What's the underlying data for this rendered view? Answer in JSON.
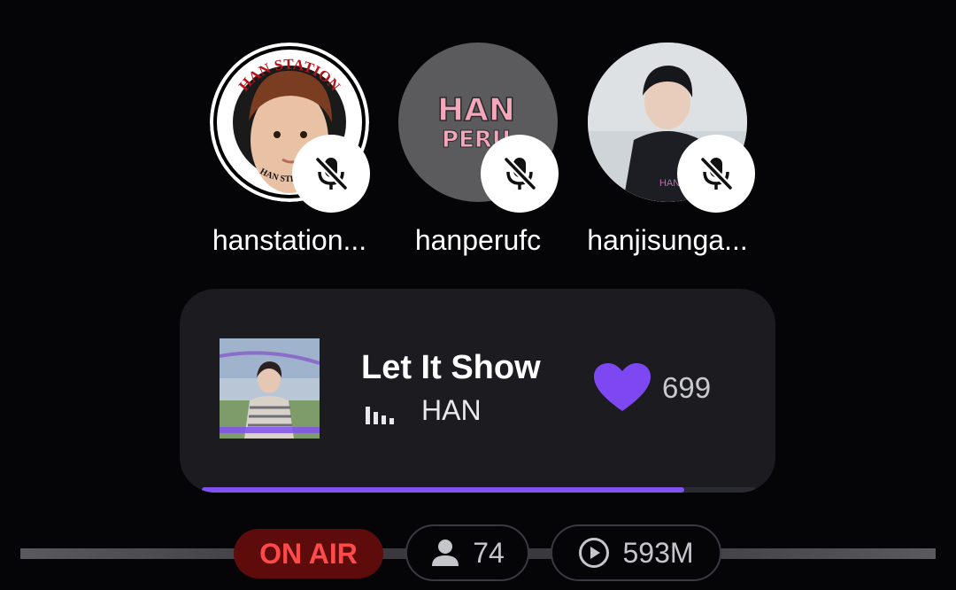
{
  "speakers": [
    {
      "name": "hanstation...",
      "avatar_text_top": "HAN STATION",
      "avatar_text_bottom": "HAN STREAMI",
      "muted": true
    },
    {
      "name": "hanperufc",
      "avatar_text_line1": "HAN",
      "avatar_text_line2": "PERU",
      "muted": true
    },
    {
      "name": "hanjisunga...",
      "avatar_text": "HAN JISUN",
      "muted": true
    }
  ],
  "now_playing": {
    "title": "Let It Show",
    "artist": "HAN",
    "likes": "699",
    "progress": 0.87
  },
  "status": {
    "on_air": "ON AIR",
    "listeners": "74",
    "plays": "593M"
  },
  "colors": {
    "accent": "#8152f0",
    "heart": "#7d47f2",
    "on_air_bg": "#5e0b0c",
    "on_air_text": "#ff4a4a"
  }
}
